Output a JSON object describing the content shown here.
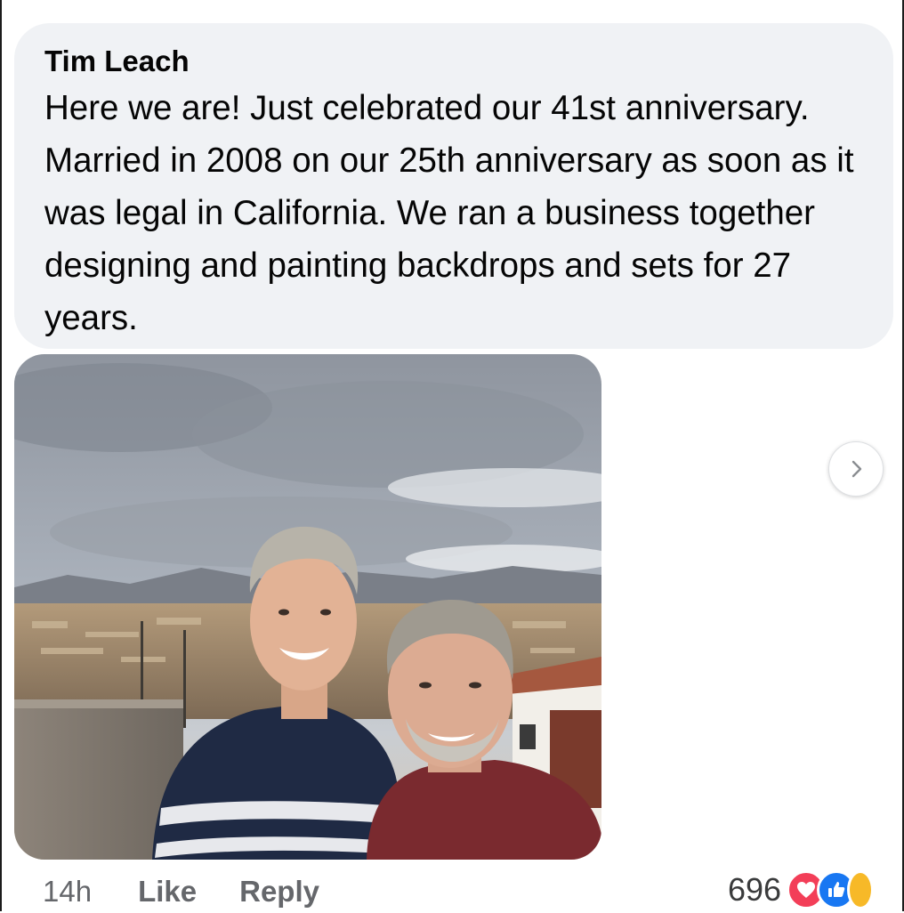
{
  "comment": {
    "author": "Tim Leach",
    "text": "Here we are! Just celebrated our 41st anniversary. Married in 2008 on our 25th anniversary as soon as it was legal in California. We ran a business together designing and painting backdrops and sets for 27 years."
  },
  "footer": {
    "timestamp": "14h",
    "like_label": "Like",
    "reply_label": "Reply",
    "reaction_count": "696",
    "reaction_icons": [
      "love-icon",
      "like-icon",
      "haha-icon"
    ]
  },
  "navigation": {
    "next_icon": "chevron-right-icon"
  },
  "colors": {
    "bubble": "#f0f2f5",
    "meta_text": "#65676b",
    "love": "#f33e58",
    "like": "#1877f2",
    "haha": "#f7b928"
  }
}
